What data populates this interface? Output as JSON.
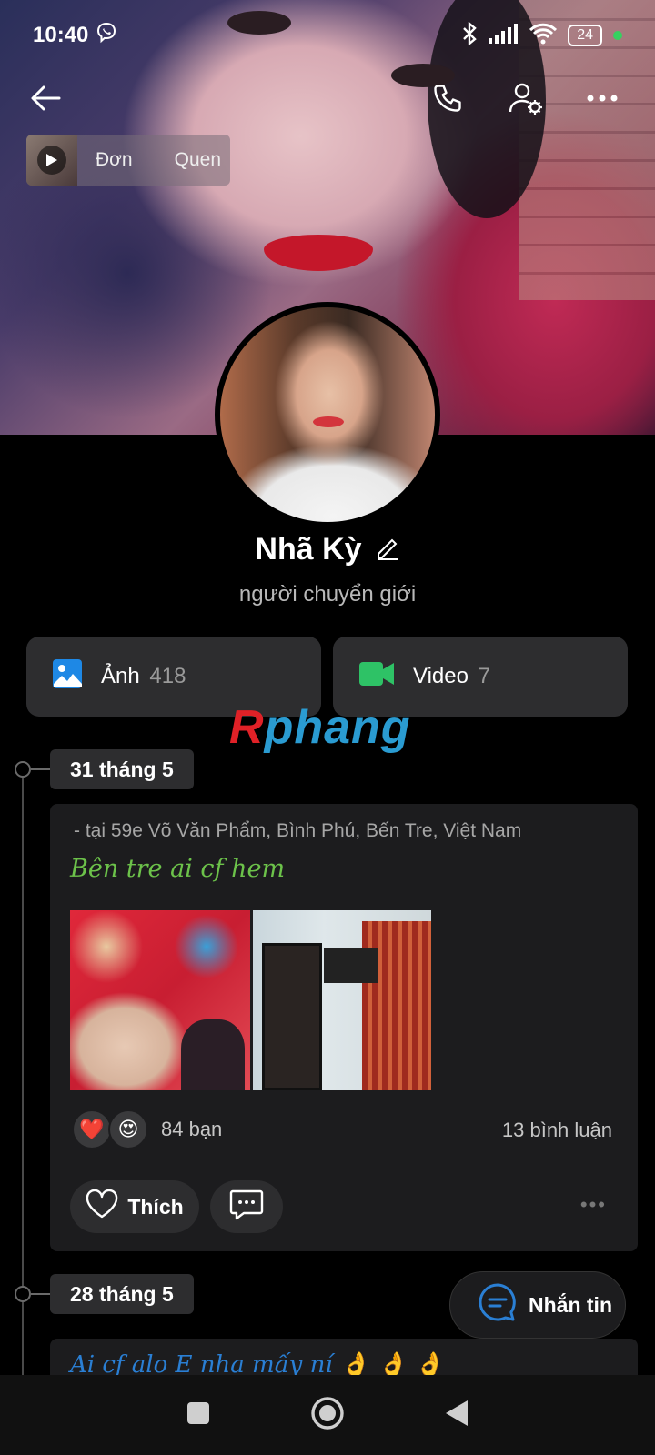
{
  "status_bar": {
    "time": "10:40",
    "battery": "24"
  },
  "music": {
    "title": "Đơn",
    "artist": "Quen"
  },
  "profile": {
    "name": "Nhã Kỳ",
    "subtitle": "người chuyển giới"
  },
  "media": {
    "photos": {
      "label": "Ảnh",
      "count": "418"
    },
    "videos": {
      "label": "Video",
      "count": "7"
    }
  },
  "watermark": {
    "part1": "R",
    "part2": "phang"
  },
  "timeline": [
    {
      "date": "31 tháng 5",
      "location": "- tại 59e Võ Văn Phẩm, Bình Phú, Bến Tre, Việt Nam",
      "text": "Bên tre ai cf hem",
      "reactions": [
        "❤️",
        "😍"
      ],
      "reaction_count": "84 bạn",
      "comments": "13 bình luận",
      "like_label": "Thích"
    },
    {
      "date": "28 tháng 5",
      "text": "Ai cf alo E nha mấy ní 👌 👌 👌"
    }
  ],
  "message_button": {
    "label": "Nhắn tin"
  },
  "colors": {
    "accent_blue": "#2a7fd4",
    "post_text_green": "#6cc24a",
    "video_green": "#2ec266",
    "photo_blue": "#1e88e5"
  }
}
